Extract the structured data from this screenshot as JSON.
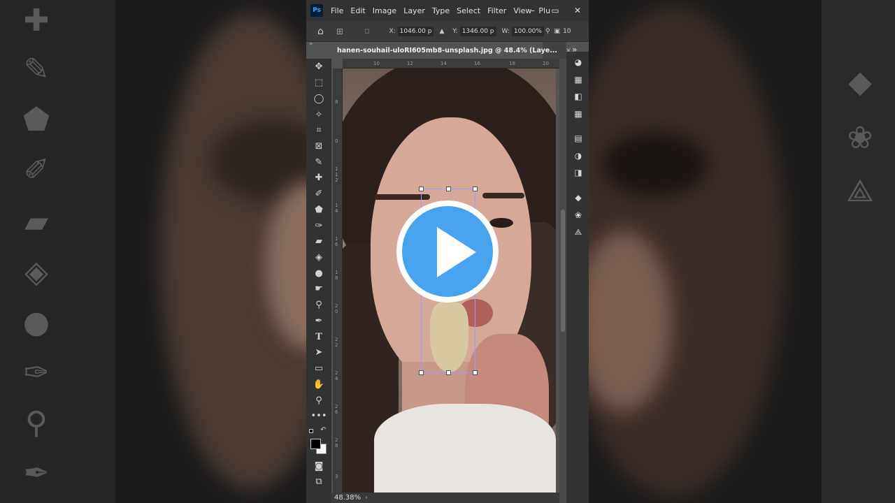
{
  "app": {
    "logo": "Ps",
    "menu": [
      "File",
      "Edit",
      "Image",
      "Layer",
      "Type",
      "Select",
      "Filter",
      "View",
      "Plu"
    ],
    "window_controls": [
      "–",
      "▭",
      "✕"
    ]
  },
  "options_bar": {
    "x_label": "X:",
    "x_value": "1046.00 p",
    "y_label": "Y:",
    "y_value": "1346.00 p",
    "w_label": "W:",
    "w_value": "100.00%",
    "trailing": "10"
  },
  "document": {
    "tab_title": "hanen-souhail-uloRI605mb8-unsplash.jpg @ 48.4% (Laye...",
    "tab_close": "×",
    "zoom": "48.38%"
  },
  "rulers": {
    "horizontal": [
      "10",
      "12",
      "14",
      "16",
      "18",
      "20"
    ],
    "vertical": [
      "8",
      "0",
      "1",
      "1",
      "2",
      "1",
      "4",
      "1",
      "6",
      "1",
      "8",
      "2",
      "0",
      "2",
      "2",
      "2",
      "4",
      "2",
      "6",
      "2",
      "8",
      "3"
    ]
  },
  "tools": [
    "move-tool-icon",
    "marquee-tool-icon",
    "lasso-tool-icon",
    "magic-wand-icon",
    "crop-tool-icon",
    "frame-tool-icon",
    "eyedropper-icon",
    "healing-brush-icon",
    "brush-tool-icon",
    "clone-stamp-icon",
    "history-brush-icon",
    "eraser-icon",
    "paint-bucket-icon",
    "blur-tool-icon",
    "smudge-tool-icon",
    "dodge-tool-icon",
    "pen-tool-icon",
    "type-tool-icon",
    "path-select-icon",
    "rectangle-tool-icon",
    "hand-tool-icon",
    "zoom-tool-icon",
    "more-tools-icon"
  ],
  "panels": [
    "color-panel-icon",
    "swatches-panel-icon",
    "gradients-panel-icon",
    "patterns-panel-icon",
    "libraries-panel-icon",
    "adjustments-panel-icon",
    "properties-panel-icon",
    "layers-panel-icon",
    "channels-panel-icon",
    "paths-panel-icon"
  ],
  "colors": {
    "foreground": "#000000",
    "background": "#ffffff",
    "play_button": "#4aa3ee",
    "selection": "#9c9cff"
  },
  "overlay": {
    "play_icon": "play-icon"
  }
}
